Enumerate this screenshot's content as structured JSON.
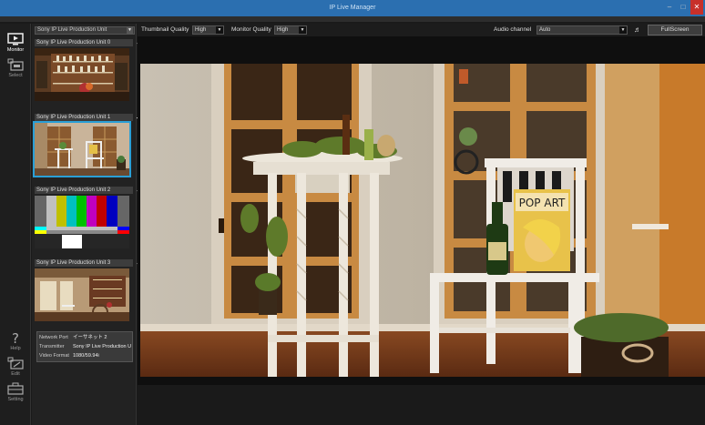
{
  "window": {
    "title": "IP Live Manager",
    "min_icon": "minimize-icon",
    "max_icon": "maximize-icon",
    "close_icon": "close-icon"
  },
  "rail": {
    "items": [
      {
        "label": "Monitor",
        "icon": "monitor-icon",
        "active": true
      },
      {
        "label": "Select",
        "icon": "select-icon",
        "active": false
      },
      {
        "label": "Help",
        "icon": "help-icon",
        "active": false
      },
      {
        "label": "Edit",
        "icon": "edit-icon",
        "active": false
      },
      {
        "label": "Setting",
        "icon": "setting-icon",
        "active": false
      }
    ]
  },
  "thumbnails": {
    "unit_select": "Sony IP Live Production Unit",
    "units": [
      {
        "label": "Sony IP Live Production Unit  0"
      },
      {
        "label": "Sony IP Live Production Unit  1"
      },
      {
        "label": "Sony IP Live Production Unit  2"
      },
      {
        "label": "Sony IP Live Production Unit  3"
      }
    ],
    "info": {
      "network_port_label": "Network Port",
      "network_port_value": "イーサネット 2",
      "transmitter_label": "Transmitter",
      "transmitter_value": "Sony IP Live Production U",
      "video_format_label": "Video Format",
      "video_format_value": "1080/59.94i"
    }
  },
  "controls": {
    "thumbnail_quality_label": "Thumbnail Quality",
    "thumbnail_quality_value": "High",
    "monitor_quality_label": "Monitor Quality",
    "monitor_quality_value": "High",
    "audio_channel_label": "Audio channel",
    "audio_channel_value": "Auto",
    "fullscreen_label": "FullScreen"
  },
  "colors": {
    "accent": "#2a9fd6",
    "titlebar": "#2b6fb0",
    "close": "#c7302a"
  }
}
